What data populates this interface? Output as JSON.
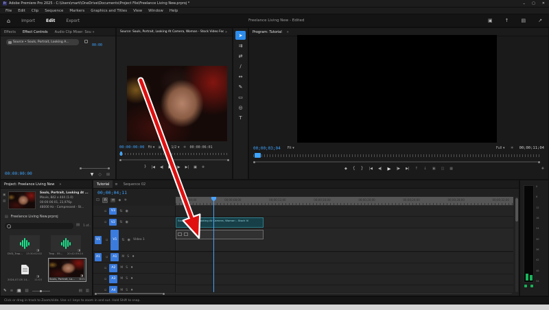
{
  "titlebar": {
    "app_badge": "Pr",
    "title": "Adobe Premiere Pro 2025 - C:\\Users\\marti\\OneDrive\\Documents\\Project File\\Freelance Living New.prproj *",
    "minimize": "–",
    "maximize": "▢",
    "close": "✕"
  },
  "menubar": {
    "items": [
      "File",
      "Edit",
      "Clip",
      "Sequence",
      "Markers",
      "Graphics and Titles",
      "View",
      "Window",
      "Help"
    ]
  },
  "header": {
    "home_icon": "⌂",
    "nav_import": "Import",
    "nav_edit": "Edit",
    "nav_export": "Export",
    "project_status": "Freelance Living New - Edited",
    "icon_resize": "▣",
    "icon_quick_export": "↑",
    "icon_workspaces": "▤",
    "icon_fullscreen": "↗"
  },
  "effect_controls": {
    "tab_effects": "Effects",
    "tab_effect_controls": "Effect Controls",
    "tab_audio_mixer": "Audio Clip Mixer: Souls, Portrait, Look",
    "tab_overflow": "»",
    "source_button": "Source • Souls, Portrait, Looking A...",
    "mini_timecode": "00:00",
    "bottom_timecode": "00:00:00:00",
    "icon_funnel": "▼",
    "icon_keyframe": "◇",
    "icon_nav": "⊞"
  },
  "source_monitor": {
    "tab": "Source: Souls, Portrait, Looking At Camera, Woman - Stock Video Footage - A",
    "tab_overflow": "»",
    "timecode": "00:00:00:00",
    "fit": "Fit",
    "dropdown_arrow": "▾",
    "icon_drag_video": "▣",
    "icon_drag_audio": "∿",
    "resolution": "1/2",
    "icon_settings": "∗",
    "duration": "00:00:06:01",
    "transport": [
      {
        "name": "mark-out",
        "glyph": "}"
      },
      {
        "name": "go-to-in",
        "glyph": "|◀"
      },
      {
        "name": "step-back",
        "glyph": "◀|"
      },
      {
        "name": "play",
        "glyph": "▶"
      },
      {
        "name": "step-forward",
        "glyph": "|▶"
      },
      {
        "name": "go-to-out",
        "glyph": "▶|"
      },
      {
        "name": "export-frame",
        "glyph": "▣"
      },
      {
        "name": "button-editor",
        "glyph": "✚"
      }
    ]
  },
  "tools": [
    {
      "name": "selection-tool",
      "glyph": "➤",
      "active": true
    },
    {
      "name": "track-select-forward-tool",
      "glyph": "⇉"
    },
    {
      "name": "ripple-edit-tool",
      "glyph": "⇄"
    },
    {
      "name": "razor-tool",
      "glyph": "∕"
    },
    {
      "name": "slip-tool",
      "glyph": "↔"
    },
    {
      "name": "pen-tool",
      "glyph": "✎"
    },
    {
      "name": "rectangle-tool",
      "glyph": "▭"
    },
    {
      "name": "hand-tool",
      "glyph": "◎"
    },
    {
      "name": "type-tool",
      "glyph": "T"
    }
  ],
  "program_monitor": {
    "tab": "Program: Tutorial",
    "tab_overflow": "»",
    "timecode": "00;00;03;04",
    "fit": "Fit",
    "dropdown_arrow": "▾",
    "playback_resolution": "Full",
    "icon_settings": "∗",
    "duration": "00;00;11;04",
    "button_editor": "✚",
    "transport": [
      {
        "name": "add-marker",
        "glyph": "◆"
      },
      {
        "name": "mark-in",
        "glyph": "{"
      },
      {
        "name": "mark-out",
        "glyph": "}"
      },
      {
        "name": "go-to-in",
        "glyph": "|◀"
      },
      {
        "name": "step-back",
        "glyph": "◀|"
      },
      {
        "name": "play",
        "glyph": "▶"
      },
      {
        "name": "step-forward",
        "glyph": "|▶"
      },
      {
        "name": "go-to-out",
        "glyph": "▶|"
      },
      {
        "name": "lift",
        "glyph": "↑"
      },
      {
        "name": "extract",
        "glyph": "↓"
      },
      {
        "name": "export-frame",
        "glyph": "▣"
      },
      {
        "name": "comparison-view",
        "glyph": "◫"
      },
      {
        "name": "multicam-view",
        "glyph": "▦"
      }
    ]
  },
  "project_panel": {
    "tab": "Project: Freelance Living New",
    "tab_overflow": "»",
    "icon_poster": "▣",
    "icon_film": "▤",
    "preview": {
      "line1": "Souls, Portrait, Looking At ...",
      "line2": "Movie, 842 x 444 (1.0)",
      "line3": "00:00:06:01, 23,976p",
      "line4": "48000 Hz - Compressed - St..."
    },
    "bin_icon": "▤",
    "bin_name": "Freelance Living New.prproj",
    "search_info_icon": "▤",
    "items_count": "1 of...",
    "badge_icon": "◨",
    "items": [
      {
        "name": "DVD_Trap...",
        "meta": "13:30:02:02",
        "type": "audio"
      },
      {
        "name": "Trap - 55...",
        "meta": "20:42:39:24",
        "type": "audio"
      },
      {
        "name": "2024-07-05 14...",
        "meta": "11:03",
        "type": "document"
      },
      {
        "name": "Souls, Portrait, Lo...",
        "meta": "8:01",
        "type": "video"
      }
    ],
    "footer": {
      "icon_edit": "✎",
      "icon_list_view": "≡",
      "icon_icon_view": "▦",
      "icon_freeform_view": "▧",
      "icon_sort": "▤",
      "icon_new_bin": "▥"
    }
  },
  "timeline": {
    "tab_active": "Tutorial",
    "tab_menu": "≡",
    "tab_inactive": "Sequence 02",
    "timecode": "00;00;04;11",
    "toolbar": [
      {
        "name": "nest",
        "glyph": "⊡"
      },
      {
        "name": "snap",
        "glyph": "∩"
      },
      {
        "name": "linked-selection",
        "glyph": "∞"
      },
      {
        "name": "add-marker",
        "glyph": "◆"
      },
      {
        "name": "settings",
        "glyph": "∗"
      }
    ],
    "ruler_labels": [
      "00;00;04;00",
      "00;00;08;00",
      "00;00;12;00",
      "00;00;16;00",
      "00;00;20;00",
      "00;00;24;00",
      "00;00;28;00",
      "00;00;32;00"
    ],
    "clip_label": "Souls, Portrait, Looking At Camera, Woman - Stock Vi",
    "clip_fx": "fx",
    "video_tracks": [
      "V3",
      "V2",
      "V1"
    ],
    "v1_label": "Video 1",
    "source_patch_video": "V1",
    "source_patch_audio": "A1",
    "audio_tracks": [
      "A1",
      "A2",
      "A3",
      "A4"
    ],
    "lock_icon": "▫",
    "sync_icon": "⇅",
    "eye_icon": "◉",
    "mute": "M",
    "solo": "S",
    "mic_icon": "♦"
  },
  "meters": {
    "scale": [
      "0",
      "6",
      "12",
      "18",
      "24",
      "30",
      "36",
      "42",
      "48",
      "54"
    ]
  },
  "status_bar": {
    "hint": "Click or drag in track to Zoom/slide. Use +/- keys to zoom in and out. Hold Shift to snap."
  },
  "colors": {
    "accent_blue": "#2d8ceb",
    "timecode_blue": "#3ea4ff",
    "clip_teal": "#173f47",
    "audio_green": "#19e68c",
    "arrow_red": "#e01010"
  }
}
